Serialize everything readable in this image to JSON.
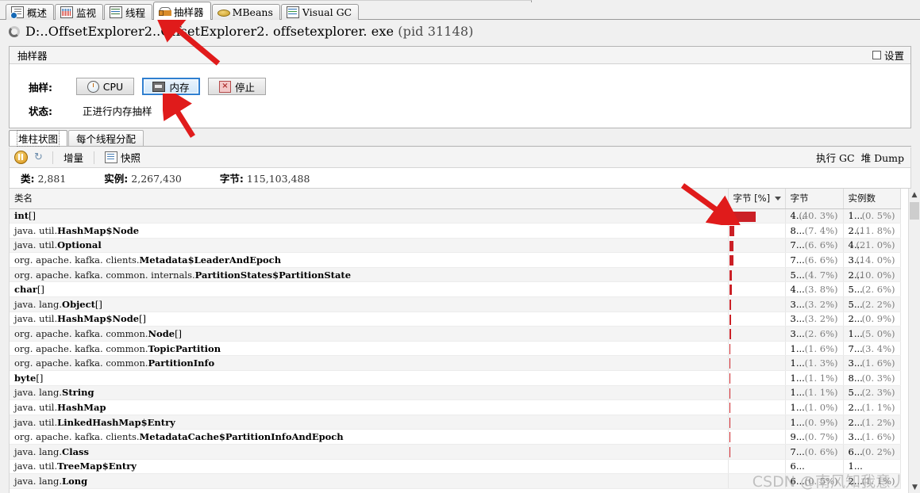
{
  "window": {
    "tabs": [
      {
        "label": "概述",
        "icon": "overview-icon",
        "active": false
      },
      {
        "label": "监视",
        "icon": "monitor-icon",
        "active": false
      },
      {
        "label": "线程",
        "icon": "threads-icon",
        "active": false
      },
      {
        "label": "抽样器",
        "icon": "sampler-icon",
        "active": true
      },
      {
        "label": "MBeans",
        "icon": "mbeans-icon",
        "active": false
      },
      {
        "label": "Visual GC",
        "icon": "visual-gc-icon",
        "active": false
      }
    ]
  },
  "process": {
    "icon": "loading-spinner-icon",
    "path": "D:..OffsetExplorer2..OffsetExplorer2. offsetexplorer. exe",
    "pid": "(pid 31148)"
  },
  "sampler_panel": {
    "title": "抽样器",
    "settings_label": "设置",
    "sample_label": "抽样:",
    "buttons": [
      {
        "label": "CPU",
        "icon": "clock-icon",
        "focused": false
      },
      {
        "label": "内存",
        "icon": "memory-icon",
        "focused": true
      },
      {
        "label": "停止",
        "icon": "stop-x-icon",
        "focused": false
      }
    ],
    "status_label": "状态:",
    "status_value": "正进行内存抽样"
  },
  "inner_tabs": [
    {
      "label": "堆柱状图",
      "active": true
    },
    {
      "label": "每个线程分配",
      "active": false
    }
  ],
  "table_toolbar": {
    "pause_icon": "pause-icon",
    "refresh_icon": "refresh-icon",
    "delta_label": "增量",
    "snapshot_icon": "snapshot-icon",
    "snapshot_label": "快照",
    "perform_gc_label": "执行 GC",
    "heap_dump_label": "堆 Dump"
  },
  "stats": [
    {
      "label": "类:",
      "value": "2,881"
    },
    {
      "label": "实例:",
      "value": "2,267,430"
    },
    {
      "label": "字节:",
      "value": "115,103,488"
    }
  ],
  "accent_color": "#cb2026",
  "table": {
    "columns": [
      "类名",
      "",
      "字节 [%]",
      "字节",
      "实例数"
    ],
    "sorted_column": "字节 [%]",
    "sort_direction": "desc",
    "rows": [
      {
        "pkg": "",
        "nm": "int",
        "suffix": "[]",
        "bytes_pct": 40.3,
        "bytes": "4...",
        "bytes_pct_text": "(40. 3%)",
        "instances": "1...",
        "inst_pct_text": "(0. 5%)"
      },
      {
        "pkg": "java. util.",
        "nm": "HashMap$Node",
        "suffix": "",
        "bytes_pct": 7.4,
        "bytes": "8...",
        "bytes_pct_text": "(7. 4%)",
        "instances": "2...",
        "inst_pct_text": "(11. 8%)"
      },
      {
        "pkg": "java. util.",
        "nm": "Optional",
        "suffix": "",
        "bytes_pct": 6.6,
        "bytes": "7...",
        "bytes_pct_text": "(6. 6%)",
        "instances": "4...",
        "inst_pct_text": "(21. 0%)"
      },
      {
        "pkg": "org. apache. kafka. clients.",
        "nm": "Metadata$LeaderAndEpoch",
        "suffix": "",
        "bytes_pct": 6.6,
        "bytes": "7...",
        "bytes_pct_text": "(6. 6%)",
        "instances": "3...",
        "inst_pct_text": "(14. 0%)"
      },
      {
        "pkg": "org. apache. kafka. common. internals.",
        "nm": "PartitionStates$PartitionState",
        "suffix": "",
        "bytes_pct": 4.7,
        "bytes": "5...",
        "bytes_pct_text": "(4. 7%)",
        "instances": "2...",
        "inst_pct_text": "(10. 0%)"
      },
      {
        "pkg": "",
        "nm": "char",
        "suffix": "[]",
        "bytes_pct": 3.8,
        "bytes": "4...",
        "bytes_pct_text": "(3. 8%)",
        "instances": "5...",
        "inst_pct_text": "(2. 6%)"
      },
      {
        "pkg": "java. lang.",
        "nm": "Object",
        "suffix": "[]",
        "bytes_pct": 3.2,
        "bytes": "3...",
        "bytes_pct_text": "(3. 2%)",
        "instances": "5...",
        "inst_pct_text": "(2. 2%)"
      },
      {
        "pkg": "java. util.",
        "nm": "HashMap$Node",
        "suffix": "[]",
        "bytes_pct": 3.2,
        "bytes": "3...",
        "bytes_pct_text": "(3. 2%)",
        "instances": "2...",
        "inst_pct_text": "(0. 9%)"
      },
      {
        "pkg": "org. apache. kafka. common.",
        "nm": "Node",
        "suffix": "[]",
        "bytes_pct": 2.6,
        "bytes": "3...",
        "bytes_pct_text": "(2. 6%)",
        "instances": "1...",
        "inst_pct_text": "(5. 0%)"
      },
      {
        "pkg": "org. apache. kafka. common.",
        "nm": "TopicPartition",
        "suffix": "",
        "bytes_pct": 1.6,
        "bytes": "1...",
        "bytes_pct_text": "(1. 6%)",
        "instances": "7...",
        "inst_pct_text": "(3. 4%)"
      },
      {
        "pkg": "org. apache. kafka. common.",
        "nm": "PartitionInfo",
        "suffix": "",
        "bytes_pct": 1.3,
        "bytes": "1...",
        "bytes_pct_text": "(1. 3%)",
        "instances": "3...",
        "inst_pct_text": "(1. 6%)"
      },
      {
        "pkg": "",
        "nm": "byte",
        "suffix": "[]",
        "bytes_pct": 1.1,
        "bytes": "1...",
        "bytes_pct_text": "(1. 1%)",
        "instances": "8...",
        "inst_pct_text": "(0. 3%)"
      },
      {
        "pkg": "java. lang.",
        "nm": "String",
        "suffix": "",
        "bytes_pct": 1.1,
        "bytes": "1...",
        "bytes_pct_text": "(1. 1%)",
        "instances": "5...",
        "inst_pct_text": "(2. 3%)"
      },
      {
        "pkg": "java. util.",
        "nm": "HashMap",
        "suffix": "",
        "bytes_pct": 1.0,
        "bytes": "1...",
        "bytes_pct_text": "(1. 0%)",
        "instances": "2...",
        "inst_pct_text": "(1. 1%)"
      },
      {
        "pkg": "java. util.",
        "nm": "LinkedHashMap$Entry",
        "suffix": "",
        "bytes_pct": 0.9,
        "bytes": "1...",
        "bytes_pct_text": "(0. 9%)",
        "instances": "2...",
        "inst_pct_text": "(1. 2%)"
      },
      {
        "pkg": "org. apache. kafka. clients.",
        "nm": "MetadataCache$PartitionInfoAndEpoch",
        "suffix": "",
        "bytes_pct": 0.7,
        "bytes": "9...",
        "bytes_pct_text": "(0. 7%)",
        "instances": "3...",
        "inst_pct_text": "(1. 6%)"
      },
      {
        "pkg": "java. lang.",
        "nm": "Class",
        "suffix": "",
        "bytes_pct": 0.6,
        "bytes": "7...",
        "bytes_pct_text": "(0. 6%)",
        "instances": "6...",
        "inst_pct_text": "(0. 2%)"
      },
      {
        "pkg": "java. util.",
        "nm": "TreeMap$Entry",
        "suffix": "",
        "bytes_pct": 0.0,
        "bytes": "6...",
        "bytes_pct_text": "",
        "instances": "1...",
        "inst_pct_text": ""
      },
      {
        "pkg": "java. lang.",
        "nm": "Long",
        "suffix": "",
        "bytes_pct": 0.0,
        "bytes": "6...",
        "bytes_pct_text": "(0. 5%)",
        "instances": "2...",
        "inst_pct_text": "(1. 1%)"
      }
    ]
  },
  "scrollbar": {
    "up_arrow": "chevron-up-icon",
    "down_arrow": "chevron-down-icon"
  },
  "watermark": "CSDN @南风知我意丿"
}
